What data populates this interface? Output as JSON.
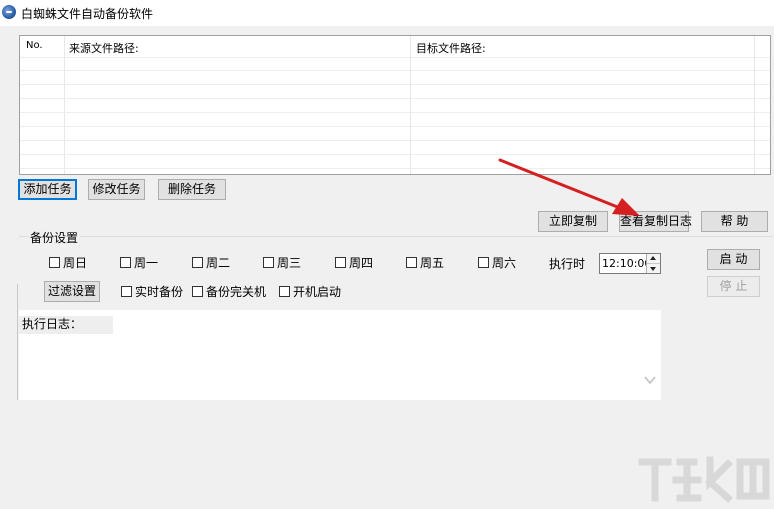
{
  "window": {
    "title": "白蜘蛛文件自动备份软件"
  },
  "table": {
    "columns": {
      "no": "No.",
      "source": "来源文件路径:",
      "target": "目标文件路径:"
    }
  },
  "task_buttons": {
    "add": "添加任务",
    "modify": "修改任务",
    "delete": "删除任务"
  },
  "action_buttons": {
    "copy_now": "立即复制",
    "view_log": "查看复制日志",
    "help": "帮 助"
  },
  "backup_settings": {
    "title": "备份设置",
    "weekdays": [
      "周日",
      "周一",
      "周二",
      "周三",
      "周四",
      "周五",
      "周六"
    ],
    "exec_time_label": "执行时",
    "exec_time_value": "12:10:00",
    "filter_button": "过滤设置",
    "options": [
      "实时备份",
      "备份完关机",
      "开机启动"
    ],
    "start_button": "启 动",
    "stop_button": "停 止"
  },
  "log": {
    "label": "执行日志："
  },
  "colors": {
    "arrow": "#d42020",
    "focus": "#0078d7"
  }
}
